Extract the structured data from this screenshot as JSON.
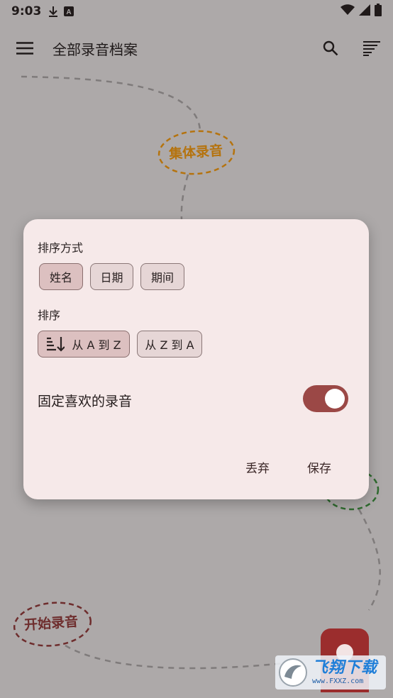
{
  "status_bar": {
    "time": "9:03",
    "left_icons": [
      "download-icon",
      "a-icon"
    ],
    "right_icons": [
      "wifi-icon",
      "signal-icon",
      "battery-icon"
    ]
  },
  "app_bar": {
    "title": "全部录音档案",
    "menu_icon": "menu-icon",
    "search_icon": "search-icon",
    "sort_icon": "sort-list-icon"
  },
  "background": {
    "group_bubble": "集体录音",
    "start_bubble": "开始录音"
  },
  "dialog": {
    "sort_by_label": "排序方式",
    "sort_by_options": [
      {
        "label": "姓名",
        "selected": true
      },
      {
        "label": "日期",
        "selected": false
      },
      {
        "label": "期间",
        "selected": false
      }
    ],
    "order_label": "排序",
    "order_options": [
      {
        "label": "从 A 到 Z",
        "selected": true,
        "icon": "sort-ascending-icon"
      },
      {
        "label": "从 Z 到 A",
        "selected": false
      }
    ],
    "pin_favorites_label": "固定喜欢的录音",
    "pin_favorites_on": true,
    "discard_label": "丢弃",
    "save_label": "保存"
  },
  "watermark": {
    "main": "飞翔下载",
    "sub": "www.FXXZ.com"
  },
  "colors": {
    "scrim": "#ada9a9",
    "dialog_bg": "#f6e9e9",
    "accent": "#9b4846",
    "selected_chip": "#dcc0c0",
    "group_bubble": "#b5730e",
    "start_bubble": "#6e2d2d",
    "fab": "#9b2d2d"
  }
}
